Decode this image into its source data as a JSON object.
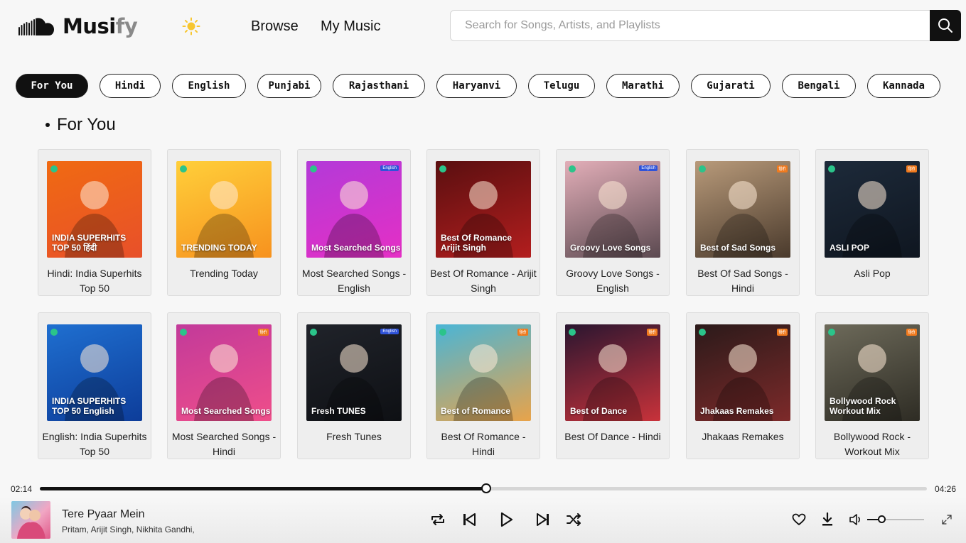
{
  "app": {
    "logo_main": "Musi",
    "logo_accent": "fy",
    "nav": {
      "browse": "Browse",
      "my_music": "My Music"
    },
    "search": {
      "placeholder": "Search for Songs, Artists, and Playlists",
      "value": ""
    }
  },
  "filters": {
    "items": [
      "For You",
      "Hindi",
      "English",
      "Punjabi",
      "Rajasthani",
      "Haryanvi",
      "Telugu",
      "Marathi",
      "Gujarati",
      "Bengali",
      "Kannada"
    ],
    "active": "For You"
  },
  "section": {
    "title": "For You"
  },
  "playlists": [
    {
      "title": "Hindi: India Superhits Top 50",
      "art_text": "INDIA SUPERHITS TOP 50 हिंदी",
      "colors": [
        "#f06a12",
        "#e8502a"
      ],
      "tag": ""
    },
    {
      "title": "Trending Today",
      "art_text": "TRENDING TODAY",
      "colors": [
        "#ffcf3a",
        "#f7921e"
      ],
      "tag": ""
    },
    {
      "title": "Most Searched Songs - English",
      "art_text": "Most Searched Songs",
      "colors": [
        "#b33ad8",
        "#e52fc5"
      ],
      "tag": "English"
    },
    {
      "title": "Best Of Romance - Arijit Singh",
      "art_text": "Best Of Romance Arijit Singh",
      "colors": [
        "#5a0f10",
        "#b31e1e"
      ],
      "tag": ""
    },
    {
      "title": "Groovy Love Songs - English",
      "art_text": "Groovy Love Songs",
      "colors": [
        "#e2aeb8",
        "#5b4950"
      ],
      "tag": "English"
    },
    {
      "title": "Best Of Sad Songs - Hindi",
      "art_text": "Best of Sad Songs",
      "colors": [
        "#b89a7a",
        "#4a3a2c"
      ],
      "tag": "हिंदी"
    },
    {
      "title": "Asli Pop",
      "art_text": "ASLI POP",
      "colors": [
        "#1d2a3a",
        "#0f1620"
      ],
      "tag": "हिंदी"
    },
    {
      "title": "English: India Superhits Top 50",
      "art_text": "INDIA SUPERHITS TOP 50 English",
      "colors": [
        "#1f6fd0",
        "#0d3d9a"
      ],
      "tag": ""
    },
    {
      "title": "Most Searched Songs - Hindi",
      "art_text": "Most Searched Songs",
      "colors": [
        "#c23a9a",
        "#ef4e8a"
      ],
      "tag": "हिंदी"
    },
    {
      "title": "Fresh Tunes",
      "art_text": "Fresh TUNES",
      "colors": [
        "#20232a",
        "#0e1014"
      ],
      "tag": "English"
    },
    {
      "title": "Best Of Romance - Hindi",
      "art_text": "Best of Romance",
      "colors": [
        "#4ab5d6",
        "#e8a34a"
      ],
      "tag": "हिंदी"
    },
    {
      "title": "Best Of Dance - Hindi",
      "art_text": "Best of Dance",
      "colors": [
        "#2a1630",
        "#c8323a"
      ],
      "tag": "हिंदी"
    },
    {
      "title": "Jhakaas Remakes",
      "art_text": "Jhakaas Remakes",
      "colors": [
        "#2b1a1a",
        "#7d2a2a"
      ],
      "tag": "हिंदी"
    },
    {
      "title": "Bollywood Rock - Workout Mix",
      "art_text": "Bollywood Rock Workout Mix",
      "colors": [
        "#6d6a5a",
        "#2e2c24"
      ],
      "tag": "हिंदी"
    }
  ],
  "player": {
    "current_time": "02:14",
    "total_time": "04:26",
    "progress": 0.503,
    "volume": 0.25,
    "track_title": "Tere Pyaar Mein",
    "artists": "Pritam, Arijit Singh, Nikhita Gandhi,"
  },
  "colors": {
    "primary": "#111111",
    "background": "#f7f7f7",
    "card": "#eeeeee",
    "badge": "#2bc48a"
  },
  "icons": [
    "soundcloud-cloud-icon",
    "sun-icon",
    "search-icon",
    "repeat-icon",
    "previous-icon",
    "play-icon",
    "next-icon",
    "shuffle-icon",
    "heart-icon",
    "download-icon",
    "volume-icon",
    "expand-icon"
  ]
}
